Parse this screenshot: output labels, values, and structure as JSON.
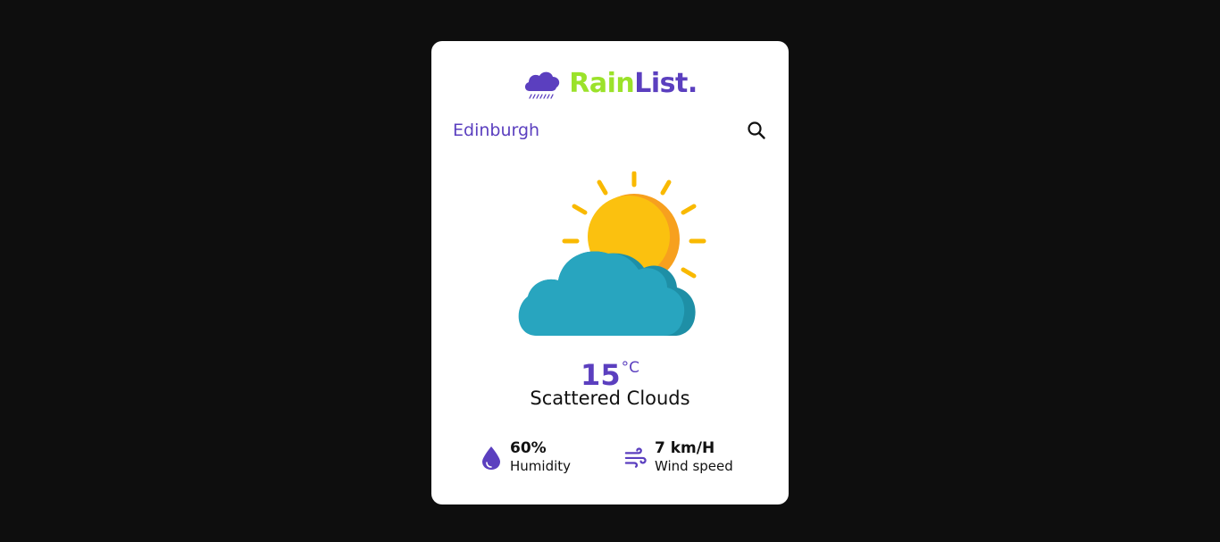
{
  "brand": {
    "name_part_1": "Rain",
    "name_part_2": "List.",
    "logo_icon": "rain-cloud-icon",
    "color_accent": "#5B3FBF",
    "color_highlight": "#9BE22A"
  },
  "location": {
    "city": "Edinburgh",
    "search_icon": "search-icon"
  },
  "weather": {
    "icon": "partly-cloudy-sun-icon",
    "temperature": "15",
    "unit": "°C",
    "description": "Scattered Clouds"
  },
  "stats": {
    "humidity": {
      "value": "60%",
      "label": "Humidity",
      "icon": "water-drop-icon"
    },
    "wind": {
      "value": "7 km/H",
      "label": "Wind speed",
      "icon": "wind-icon"
    }
  }
}
